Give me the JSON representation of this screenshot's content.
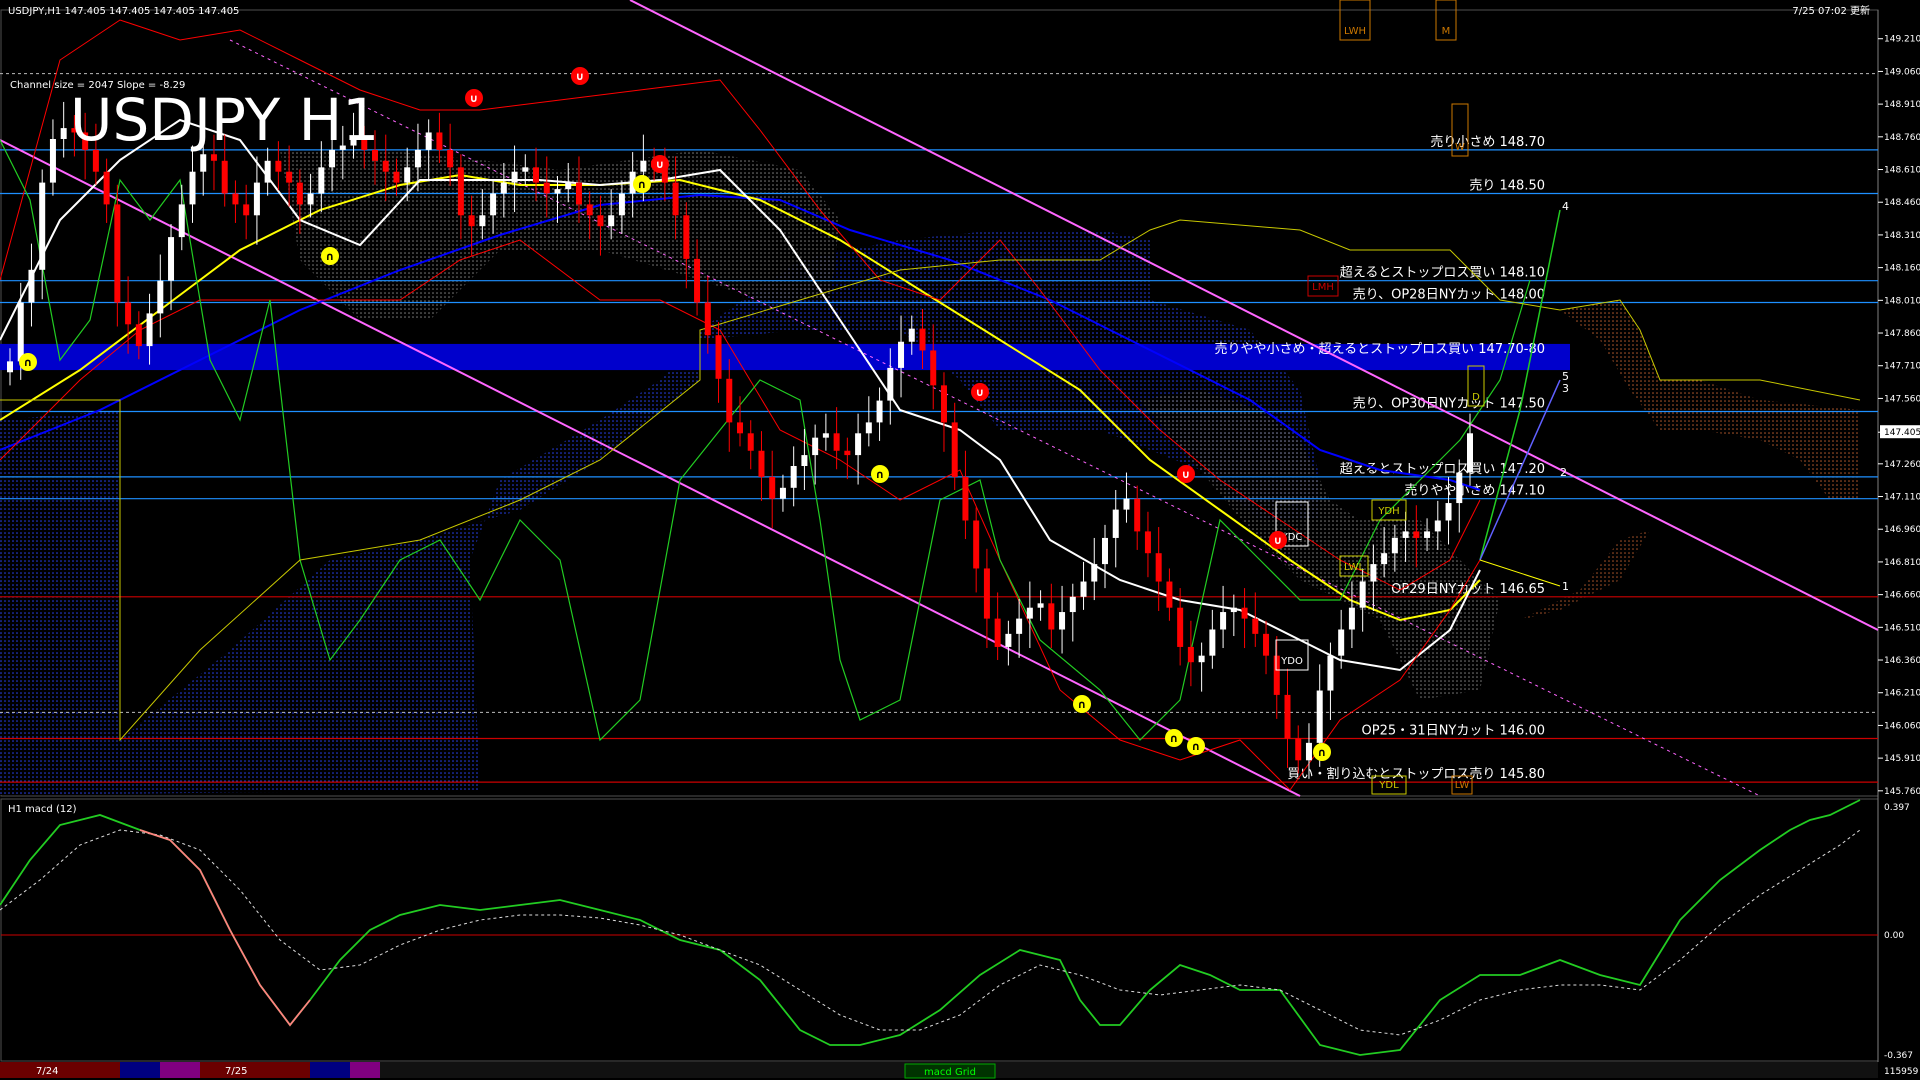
{
  "window": {
    "symbol_header": "USDJPY,H1 147.405 147.405 147.405 147.405",
    "timestamp": "7/25 07:02 更新",
    "big_title": "USDJPY H1",
    "channel_info": "Channel size = 2047 Slope = -8.29"
  },
  "price_scale": {
    "labels": [
      "149.210",
      "149.060",
      "148.910",
      "148.760",
      "148.610",
      "148.460",
      "148.310",
      "148.160",
      "148.010",
      "147.860",
      "147.710",
      "147.560",
      "147.405",
      "147.260",
      "147.110",
      "146.960",
      "146.810",
      "146.660",
      "146.510",
      "146.360",
      "146.210",
      "146.060",
      "145.910",
      "145.760"
    ],
    "current": "147.405"
  },
  "levels": [
    {
      "label": "売り小さめ 148.70",
      "price": 148.7,
      "color": "#1e90ff"
    },
    {
      "label": "売り 148.50",
      "price": 148.5,
      "color": "#1e90ff"
    },
    {
      "label": "超えるとストップロス買い 148.10",
      "price": 148.1,
      "color": "#1e90ff"
    },
    {
      "label": "売り、OP28日NYカット 148.00",
      "price": 148.0,
      "color": "#1e90ff"
    },
    {
      "label": "売りやや小さめ・超えるとストップロス買い 147.70-80",
      "price": 147.75,
      "color": "#0000cc"
    },
    {
      "label": "売り、OP30日NYカット 147.50",
      "price": 147.5,
      "color": "#1e90ff"
    },
    {
      "label": "超えるとストップロス買い 147.20",
      "price": 147.2,
      "color": "#1e90ff"
    },
    {
      "label": "売りやや小さめ 147.10",
      "price": 147.1,
      "color": "#1e90ff"
    },
    {
      "label": "OP29日NYカット 146.65",
      "price": 146.65,
      "color": "#cc0000"
    },
    {
      "label": "OP25・31日NYカット 146.00",
      "price": 146.0,
      "color": "#cc0000"
    },
    {
      "label": "買い・割り込むとストップロス売り 145.80",
      "price": 145.8,
      "color": "#cc0000"
    }
  ],
  "boxes": [
    "LWH",
    "M",
    "W",
    "LMH",
    "D",
    "YDC",
    "YDH",
    "LWL",
    "YDO",
    "YDL",
    "LW"
  ],
  "wave_labels": [
    "1",
    "2",
    "3",
    "4",
    "5"
  ],
  "macd": {
    "label": "H1 macd (12)",
    "scale": [
      "0.397",
      "0.00",
      "-0.367"
    ],
    "volume_label": "115959"
  },
  "time_axis": {
    "labels": [
      "7/24",
      "7/25"
    ],
    "tab_label": "macd Grid"
  },
  "colors": {
    "up": "#ffffff",
    "down": "#ff0000",
    "ma_white": "#ffffff",
    "ma_yellow": "#ffff00",
    "ma_blue": "#0000ff",
    "channel": "#ff66ff",
    "macd_line": "#00ff00",
    "macd_neg": "#ff8080"
  },
  "chart_data": {
    "type": "candlestick",
    "title": "USDJPY H1",
    "ylim": [
      145.75,
      149.25
    ],
    "close": [
      147.73,
      148.0,
      148.15,
      148.55,
      148.75,
      148.8,
      148.78,
      148.7,
      148.6,
      148.45,
      148.0,
      147.9,
      147.8,
      147.95,
      148.1,
      148.3,
      148.45,
      148.6,
      148.68,
      148.65,
      148.5,
      148.45,
      148.4,
      148.55,
      148.65,
      148.6,
      148.55,
      148.45,
      148.5,
      148.62,
      148.7,
      148.72,
      148.75,
      148.7,
      148.65,
      148.6,
      148.55,
      148.62,
      148.7,
      148.78,
      148.7,
      148.62,
      148.4,
      148.35,
      148.4,
      148.5,
      148.55,
      148.6,
      148.62,
      148.55,
      148.5,
      148.52,
      148.55,
      148.45,
      148.4,
      148.35,
      148.4,
      148.5,
      148.6,
      148.65,
      148.62,
      148.55,
      148.4,
      148.2,
      148.0,
      147.85,
      147.65,
      147.45,
      147.4,
      147.32,
      147.2,
      147.1,
      147.15,
      147.25,
      147.3,
      147.38,
      147.4,
      147.32,
      147.3,
      147.4,
      147.45,
      147.55,
      147.7,
      147.82,
      147.88,
      147.78,
      147.62,
      147.45,
      147.2,
      147.0,
      146.78,
      146.55,
      146.42,
      146.48,
      146.55,
      146.6,
      146.62,
      146.5,
      146.58,
      146.65,
      146.72,
      146.8,
      146.92,
      147.05,
      147.1,
      146.95,
      146.85,
      146.72,
      146.6,
      146.42,
      146.35,
      146.38,
      146.5,
      146.58,
      146.6,
      146.55,
      146.48,
      146.38,
      146.2,
      146.0,
      145.9,
      145.98,
      146.22,
      146.38,
      146.5,
      146.6,
      146.72,
      146.8,
      146.85,
      146.92,
      146.95,
      146.92,
      146.95,
      147.0,
      147.08,
      147.22,
      147.4
    ]
  }
}
